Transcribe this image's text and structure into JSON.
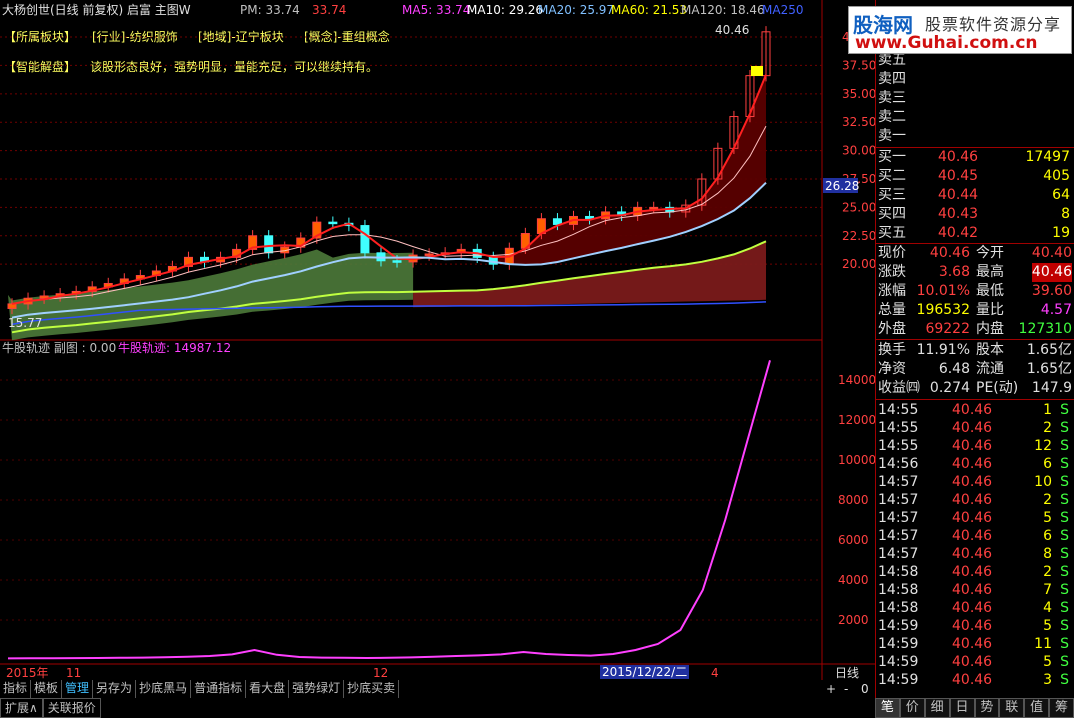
{
  "header": {
    "title": "大杨创世(日线 前复权) 启富 主图W",
    "pm_label": "PM: 33.74",
    "pm_value": "33.74",
    "ma5": "MA5: 33.74",
    "ma10": "MA10: 29.26",
    "ma20": "MA20: 25.97",
    "ma60": "MA60: 21.53",
    "ma120": "MA120: 18.46",
    "ma250": "MA250",
    "colors": {
      "ma5": "#ff40ff",
      "ma10": "#ffffff",
      "ma20": "#80c0ff",
      "ma60": "#ffff00",
      "ma120": "#c0c0c0",
      "ma250": "#4060ff"
    }
  },
  "info": {
    "sector_tag": "【所属板块】",
    "industry": "[行业]-纺织服饰",
    "region": "[地域]-辽宁板块",
    "concept": "[概念]-重组概念",
    "ai_tag": "【智能解盘】",
    "ai_text": "该股形态良好，强势明显，量能充足，可以继续持有。"
  },
  "main_chart": {
    "price_labels": [
      "40.46",
      "15.77",
      "26.28"
    ],
    "yticks": [
      "40",
      "37.50",
      "35.00",
      "32.50",
      "30.00",
      "27.50",
      "25.00",
      "22.50",
      "20.00"
    ],
    "ylim": [
      13.5,
      41.5
    ]
  },
  "sub_chart": {
    "title": "牛股轨迹 副图 : 0.00",
    "line_label": "牛股轨迹: 14987.12",
    "yticks": [
      "14000",
      "12000",
      "10000",
      "8000",
      "6000",
      "4000",
      "2000"
    ],
    "ylim": [
      0,
      15500
    ]
  },
  "chart_data": {
    "type": "line",
    "series": [
      {
        "name": "牛股轨迹",
        "values": [
          80,
          85,
          90,
          95,
          100,
          110,
          120,
          140,
          160,
          200,
          280,
          500,
          260,
          150,
          120,
          110,
          100,
          110,
          130,
          160,
          200,
          230,
          280,
          400,
          300,
          250,
          220,
          300,
          500,
          800,
          1500,
          3500,
          7000,
          11000,
          14987
        ]
      }
    ],
    "ylim": [
      0,
      15500
    ],
    "candles_close": [
      16.5,
      17.0,
      17.2,
      17.4,
      17.6,
      18.0,
      18.3,
      18.7,
      19.0,
      19.4,
      19.8,
      20.6,
      20.2,
      20.6,
      21.3,
      22.5,
      21.0,
      21.5,
      22.3,
      23.7,
      23.6,
      23.4,
      21.0,
      20.3,
      20.2,
      20.8,
      20.9,
      21.0,
      21.3,
      20.6,
      20.0,
      21.4,
      22.7,
      24.0,
      23.5,
      24.2,
      24.0,
      24.6,
      24.3,
      25.0,
      25.0,
      24.6,
      25.2,
      27.5,
      30.2,
      33.0,
      36.6,
      40.46
    ]
  },
  "axis": {
    "x_labels": [
      "2015年",
      "11",
      "12",
      "2015/12/22/二",
      "4"
    ],
    "period": "日线"
  },
  "quote": {
    "sell": [
      {
        "label": "卖五",
        "price": "",
        "vol": ""
      },
      {
        "label": "卖四",
        "price": "",
        "vol": ""
      },
      {
        "label": "卖三",
        "price": "",
        "vol": ""
      },
      {
        "label": "卖二",
        "price": "",
        "vol": ""
      },
      {
        "label": "卖一",
        "price": "",
        "vol": ""
      }
    ],
    "buy": [
      {
        "label": "买一",
        "price": "40.46",
        "vol": "17497"
      },
      {
        "label": "买二",
        "price": "40.45",
        "vol": "405"
      },
      {
        "label": "买三",
        "price": "40.44",
        "vol": "64"
      },
      {
        "label": "买四",
        "price": "40.43",
        "vol": "8"
      },
      {
        "label": "买五",
        "price": "40.42",
        "vol": "19"
      }
    ],
    "stats": [
      {
        "l1": "现价",
        "v1": "40.46",
        "l2": "今开",
        "v2": "40.40"
      },
      {
        "l1": "涨跌",
        "v1": "3.68",
        "l2": "最高",
        "v2": "40.46"
      },
      {
        "l1": "涨幅",
        "v1": "10.01%",
        "l2": "最低",
        "v2": "39.60"
      },
      {
        "l1": "总量",
        "v1": "196532",
        "l2": "量比",
        "v2": "4.57"
      },
      {
        "l1": "外盘",
        "v1": "69222",
        "l2": "内盘",
        "v2": "127310"
      }
    ],
    "stats2": [
      {
        "l1": "换手",
        "v1": "11.91%",
        "l2": "股本",
        "v2": "1.65亿"
      },
      {
        "l1": "净资",
        "v1": "6.48",
        "l2": "流通",
        "v2": "1.65亿"
      },
      {
        "l1": "收益㈣",
        "v1": "0.274",
        "l2": "PE(动)",
        "v2": "147.9"
      }
    ],
    "ticks": [
      {
        "t": "14:55",
        "p": "40.46",
        "v": "1",
        "s": "S"
      },
      {
        "t": "14:55",
        "p": "40.46",
        "v": "2",
        "s": "S"
      },
      {
        "t": "14:55",
        "p": "40.46",
        "v": "12",
        "s": "S"
      },
      {
        "t": "14:56",
        "p": "40.46",
        "v": "6",
        "s": "S"
      },
      {
        "t": "14:57",
        "p": "40.46",
        "v": "10",
        "s": "S"
      },
      {
        "t": "14:57",
        "p": "40.46",
        "v": "2",
        "s": "S"
      },
      {
        "t": "14:57",
        "p": "40.46",
        "v": "5",
        "s": "S"
      },
      {
        "t": "14:57",
        "p": "40.46",
        "v": "6",
        "s": "S"
      },
      {
        "t": "14:57",
        "p": "40.46",
        "v": "8",
        "s": "S"
      },
      {
        "t": "14:58",
        "p": "40.46",
        "v": "2",
        "s": "S"
      },
      {
        "t": "14:58",
        "p": "40.46",
        "v": "7",
        "s": "S"
      },
      {
        "t": "14:58",
        "p": "40.46",
        "v": "4",
        "s": "S"
      },
      {
        "t": "14:59",
        "p": "40.46",
        "v": "5",
        "s": "S"
      },
      {
        "t": "14:59",
        "p": "40.46",
        "v": "11",
        "s": "S"
      },
      {
        "t": "14:59",
        "p": "40.46",
        "v": "5",
        "s": "S"
      },
      {
        "t": "14:59",
        "p": "40.46",
        "v": "3",
        "s": "S"
      }
    ]
  },
  "tabs": [
    "指标",
    "模板",
    "管理",
    "另存为",
    "抄底黑马",
    "普通指标",
    "看大盘",
    "强势绿灯",
    "抄底买卖"
  ],
  "tabs2": [
    "扩展∧",
    "关联报价"
  ],
  "zoom": {
    "plus": "+",
    "minus": "-",
    "zero": "0"
  },
  "rp_tabs": [
    "笔",
    "价",
    "细",
    "日",
    "势",
    "联",
    "值",
    "筹"
  ],
  "logo": {
    "brand": "股海网",
    "slogan": "股票软件资源分享",
    "url": "www.Guhai.com.cn"
  }
}
